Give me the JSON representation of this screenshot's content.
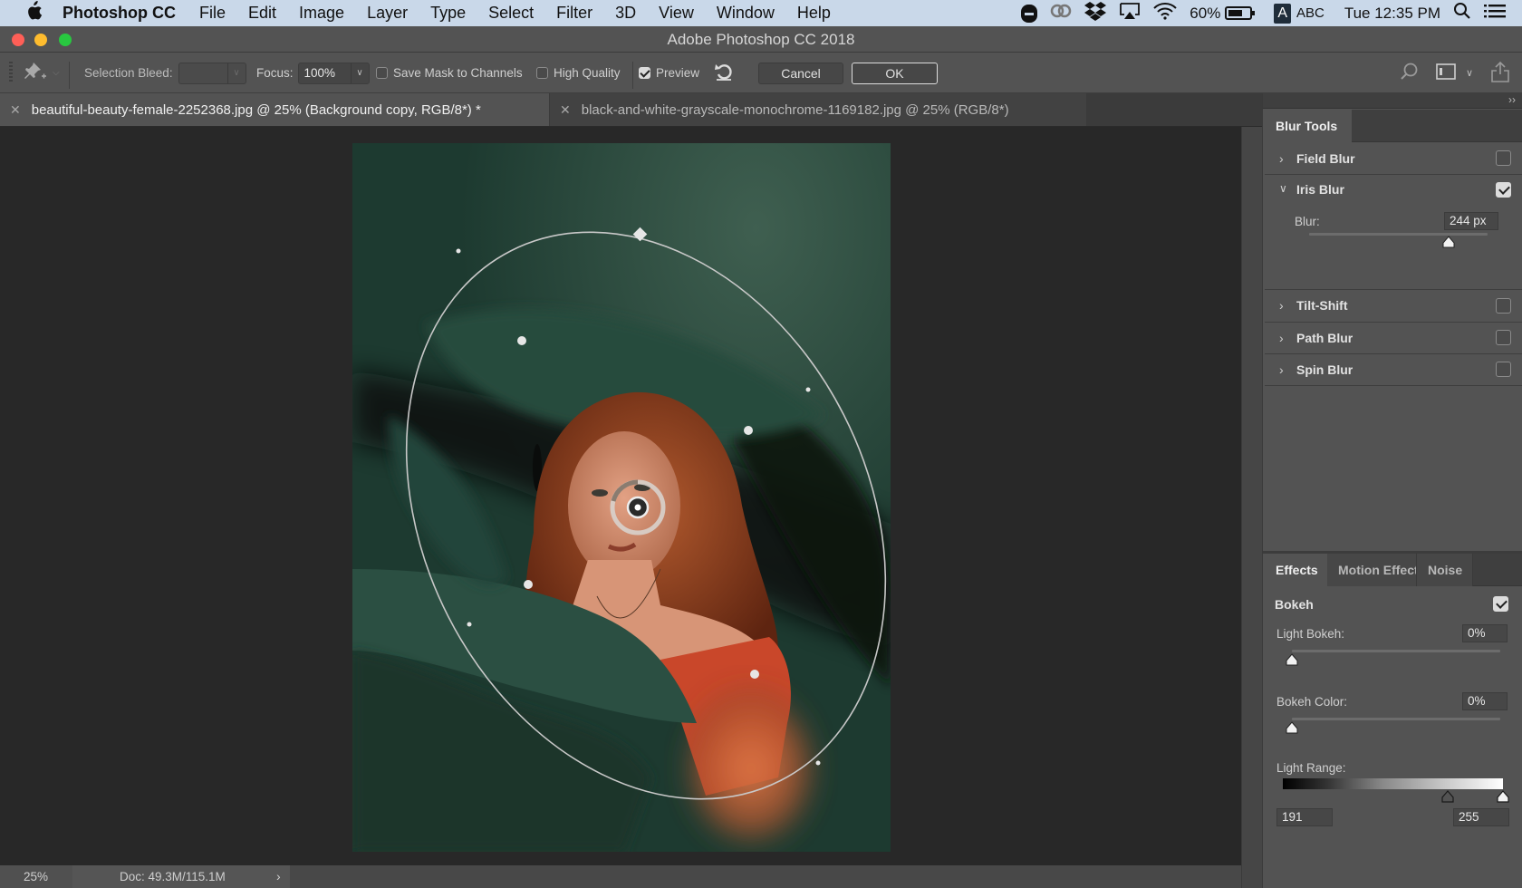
{
  "menubar": {
    "app_name": "Photoshop CC",
    "menus": [
      "File",
      "Edit",
      "Image",
      "Layer",
      "Type",
      "Select",
      "Filter",
      "3D",
      "View",
      "Window",
      "Help"
    ],
    "battery_percent": "60%",
    "input_source_badge": "A",
    "input_source": "ABC",
    "clock": "Tue 12:35 PM"
  },
  "window": {
    "title": "Adobe Photoshop CC 2018"
  },
  "options_bar": {
    "selection_bleed_label": "Selection Bleed:",
    "selection_bleed_value": "",
    "focus_label": "Focus:",
    "focus_value": "100%",
    "save_mask_label": "Save Mask to Channels",
    "save_mask_checked": false,
    "high_quality_label": "High Quality",
    "high_quality_checked": false,
    "preview_label": "Preview",
    "preview_checked": true,
    "cancel_label": "Cancel",
    "ok_label": "OK"
  },
  "tabs": [
    {
      "label": "beautiful-beauty-female-2252368.jpg @ 25% (Background copy, RGB/8*) *",
      "active": true
    },
    {
      "label": "black-and-white-grayscale-monochrome-1169182.jpg @ 25% (RGB/8*)",
      "active": false
    }
  ],
  "status_bar": {
    "zoom": "25%",
    "doc_info": "Doc: 49.3M/115.1M",
    "arrow": "›"
  },
  "blur_tools": {
    "tab_label": "Blur Tools",
    "items": [
      {
        "label": "Field Blur",
        "expanded": false,
        "checked": false
      },
      {
        "label": "Iris Blur",
        "expanded": true,
        "checked": true
      },
      {
        "label": "Tilt-Shift",
        "expanded": false,
        "checked": false
      },
      {
        "label": "Path Blur",
        "expanded": false,
        "checked": false
      },
      {
        "label": "Spin Blur",
        "expanded": false,
        "checked": false
      }
    ],
    "iris_blur": {
      "blur_label": "Blur:",
      "blur_value": "244 px",
      "blur_slider_fraction": 0.78
    }
  },
  "effects": {
    "tabs": [
      "Effects",
      "Motion Effect",
      "Noise"
    ],
    "active_tab": "Effects",
    "bokeh_label": "Bokeh",
    "bokeh_checked": true,
    "light_bokeh_label": "Light Bokeh:",
    "light_bokeh_value": "0%",
    "light_bokeh_fraction": 0.0,
    "bokeh_color_label": "Bokeh Color:",
    "bokeh_color_value": "0%",
    "bokeh_color_fraction": 0.0,
    "light_range_label": "Light Range:",
    "light_range_low": "191",
    "light_range_high": "255",
    "light_range_low_fraction": 0.749,
    "light_range_high_fraction": 1.0
  },
  "colors": {
    "traffic_close": "#fe5f57",
    "traffic_min": "#febc2e",
    "traffic_max": "#28c840",
    "menubar_bg": "#c9d8e9",
    "ui_panel": "#535353"
  }
}
